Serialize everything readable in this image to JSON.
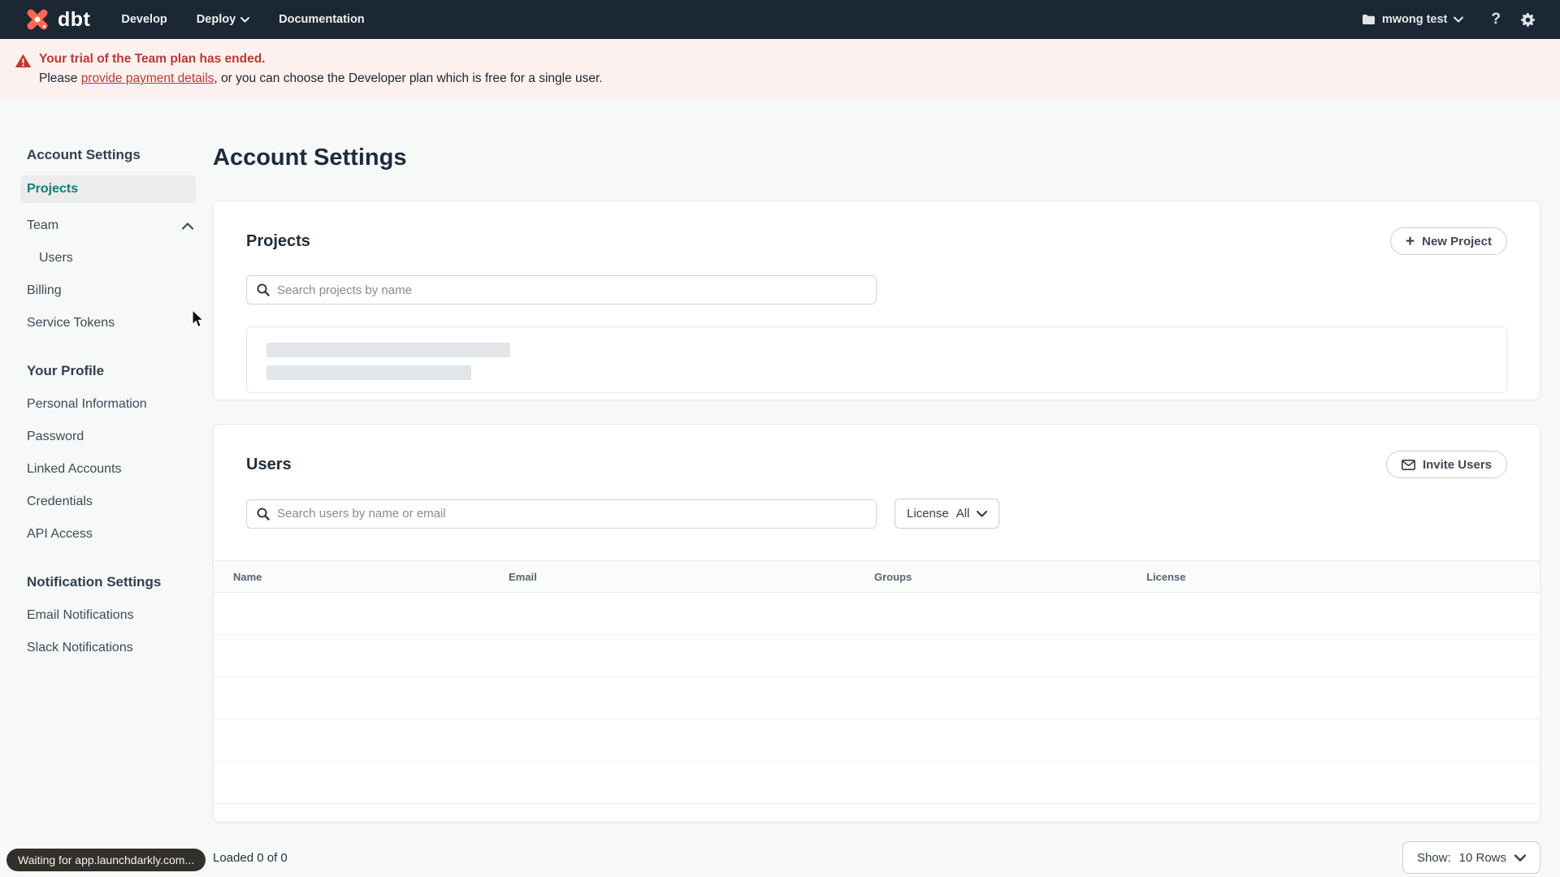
{
  "nav": {
    "logo_text": "dbt",
    "items": [
      {
        "label": "Develop"
      },
      {
        "label": "Deploy"
      },
      {
        "label": "Documentation"
      }
    ],
    "account_name": "mwong test"
  },
  "banner": {
    "title": "Your trial of the Team plan has ended.",
    "body_prefix": "Please ",
    "link_text": "provide payment details",
    "body_suffix": ", or you can choose the Developer plan which is free for a single user."
  },
  "sidebar": {
    "sections": [
      {
        "heading": "Account Settings",
        "items": [
          {
            "label": "Projects"
          },
          {
            "label": "Team"
          },
          {
            "label": "Users"
          },
          {
            "label": "Billing"
          },
          {
            "label": "Service Tokens"
          }
        ]
      },
      {
        "heading": "Your Profile",
        "items": [
          {
            "label": "Personal Information"
          },
          {
            "label": "Password"
          },
          {
            "label": "Linked Accounts"
          },
          {
            "label": "Credentials"
          },
          {
            "label": "API Access"
          }
        ]
      },
      {
        "heading": "Notification Settings",
        "items": [
          {
            "label": "Email Notifications"
          },
          {
            "label": "Slack Notifications"
          }
        ]
      }
    ]
  },
  "main": {
    "page_title": "Account Settings",
    "projects": {
      "heading": "Projects",
      "new_button_label": "New Project",
      "search_placeholder": "Search projects by name"
    },
    "users": {
      "heading": "Users",
      "invite_button_label": "Invite Users",
      "search_placeholder": "Search users by name or email",
      "license_filter_label": "License",
      "license_filter_value": "All",
      "table_headers": [
        "Name",
        "Email",
        "Groups",
        "License"
      ],
      "footer": {
        "loaded_text": "Loaded 0 of 0",
        "show_label": "Show:",
        "show_value": "10 Rows"
      }
    }
  },
  "status_bar": {
    "text": "Waiting for app.launchdarkly.com..."
  },
  "colors": {
    "brand_orange": "#ff6950",
    "nav_background": "#1b2733",
    "active_teal": "#0f7e78",
    "alert_red": "#b93a33",
    "banner_background": "#fdf1f0"
  }
}
